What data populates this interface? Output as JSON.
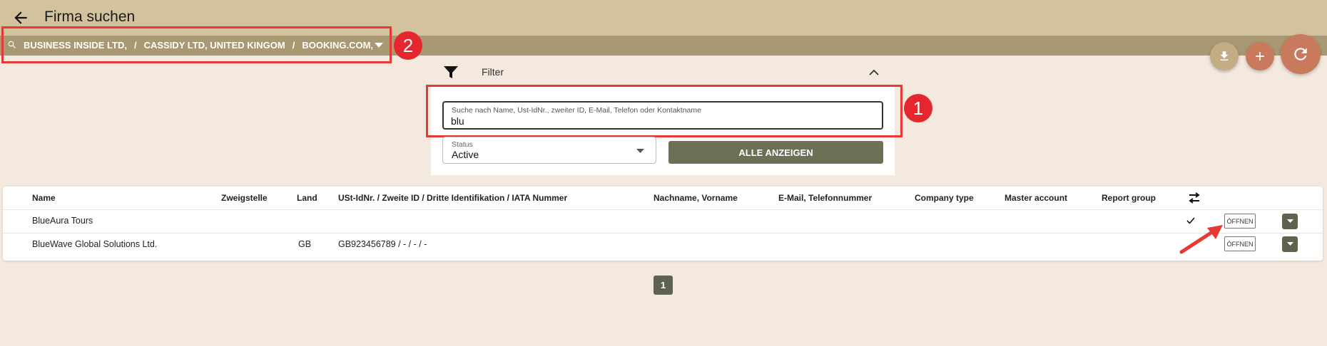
{
  "header": {
    "title": "Firma suchen"
  },
  "breadcrumb": {
    "items": [
      "BUSINESS INSIDE LTD,",
      "CASSIDY LTD, UNITED KINGOM",
      "BOOKING.COM,"
    ],
    "separator": "/"
  },
  "annotations": {
    "marker1": "1",
    "marker2": "2",
    "color": "#e53935"
  },
  "filter": {
    "title": "Filter",
    "search": {
      "label": "Suche nach Name, Ust-IdNr., zweiter ID, E-Mail, Telefon oder Kontaktname",
      "value": "blu"
    },
    "status": {
      "label": "Status",
      "value": "Active"
    },
    "show_all_label": "ALLE ANZEIGEN"
  },
  "table": {
    "columns": [
      "Name",
      "Zweigstelle",
      "Land",
      "USt-IdNr. / Zweite ID / Dritte Identifikation / IATA Nummer",
      "Nachname, Vorname",
      "E-Mail, Telefonnummer",
      "Company type",
      "Master account",
      "Report group"
    ],
    "rows": [
      {
        "name": "BlueAura Tours",
        "branch": "",
        "country": "",
        "ids": "",
        "checked": true,
        "open_label": "ÖFFNEN"
      },
      {
        "name": "BlueWave Global Solutions Ltd.",
        "branch": "",
        "country": "GB",
        "ids": "GB923456789 / - / - / -",
        "checked": false,
        "open_label": "ÖFFNEN"
      }
    ]
  },
  "pagination": {
    "current": "1"
  },
  "colors": {
    "topbar": "#d2c29e",
    "searchbar": "#a89873",
    "accent": "#c97a5c",
    "button": "#6b7056"
  }
}
